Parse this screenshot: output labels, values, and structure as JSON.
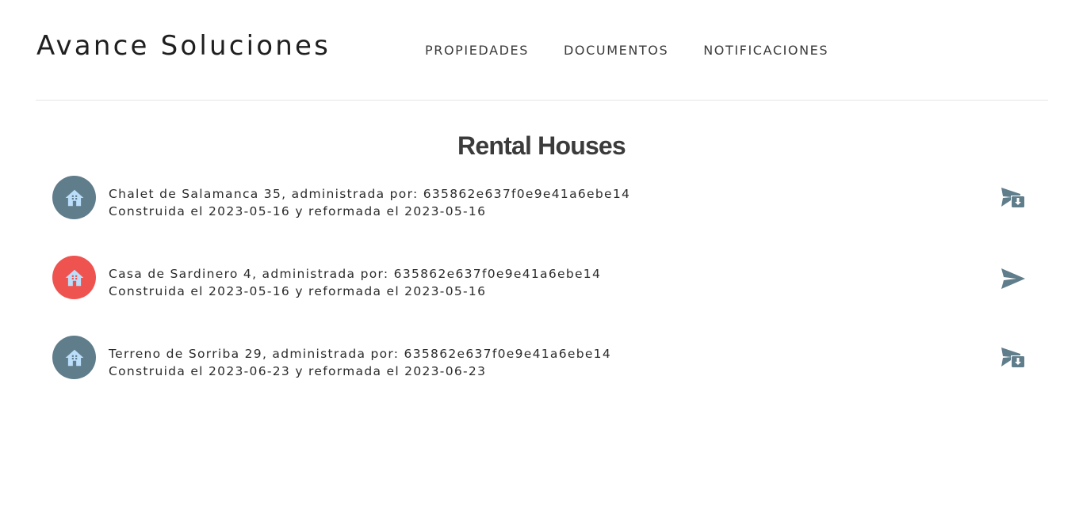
{
  "header": {
    "brand": "Avance Soluciones",
    "nav": [
      {
        "label": "PROPIEDADES"
      },
      {
        "label": "DOCUMENTOS"
      },
      {
        "label": "NOTIFICACIONES"
      }
    ]
  },
  "main": {
    "title": "Rental Houses",
    "properties": [
      {
        "line1": "Chalet de  Salamanca 35, administrada por:  635862e637f0e9e41a6ebe14",
        "line2": "Construida el 2023-05-16 y reformada el 2023-05-16",
        "avatar_color": "#607d8b",
        "avatar_icon": "house-icon",
        "action_icon": "send-download-icon"
      },
      {
        "line1": "Casa de  Sardinero 4, administrada por:  635862e637f0e9e41a6ebe14",
        "line2": "Construida el 2023-05-16 y reformada el 2023-05-16",
        "avatar_color": "#ef5350",
        "avatar_icon": "house-icon",
        "action_icon": "send-icon"
      },
      {
        "line1": "Terreno de  Sorriba 29, administrada por:  635862e637f0e9e41a6ebe14",
        "line2": "Construida el 2023-06-23 y reformada el 2023-06-23",
        "avatar_color": "#607d8b",
        "avatar_icon": "house-icon",
        "action_icon": "send-download-icon"
      }
    ]
  },
  "colors": {
    "icon_fill": "#bbdefb",
    "action_color": "#607d8b",
    "divider": "#e6e6e6"
  }
}
